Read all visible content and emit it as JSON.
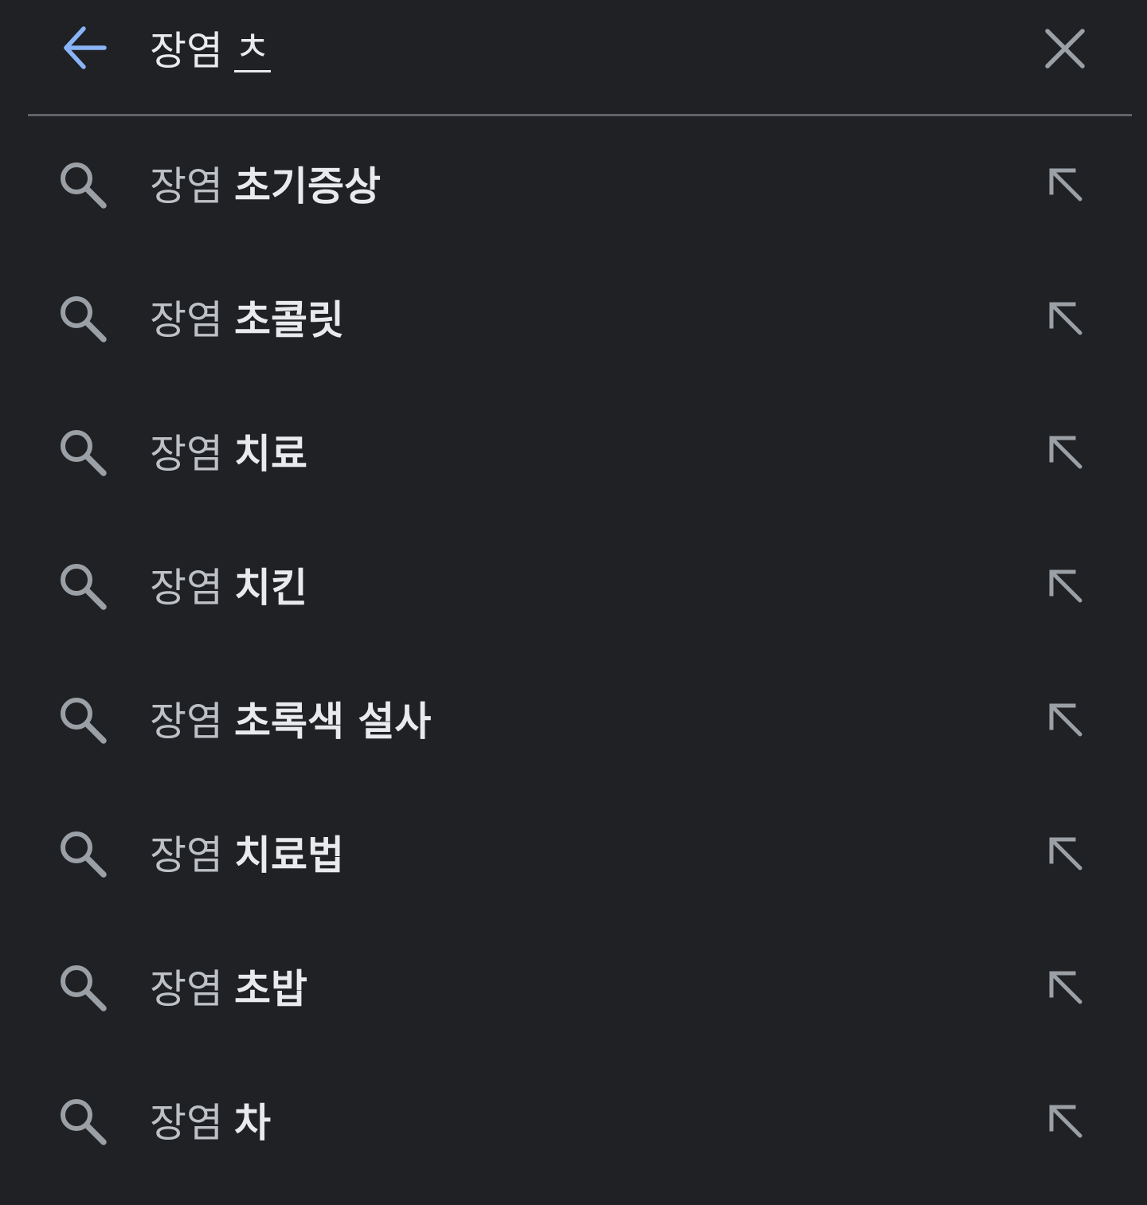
{
  "colors": {
    "background": "#202124",
    "back_arrow": "#8ab4f8",
    "icon": "#9aa0a6",
    "text_primary": "#e8eaed",
    "text_secondary": "#bdc1c6",
    "divider": "#5f6368"
  },
  "header": {
    "back_icon": "arrow-left-icon",
    "query_prefix": "장염",
    "query_composing": "ㅊ",
    "clear_icon": "close-icon"
  },
  "suggestions": [
    {
      "prefix": "장염",
      "suffix": "초기증상",
      "icon": "search-icon",
      "action_icon": "arrow-up-left-icon"
    },
    {
      "prefix": "장염",
      "suffix": "초콜릿",
      "icon": "search-icon",
      "action_icon": "arrow-up-left-icon"
    },
    {
      "prefix": "장염",
      "suffix": "치료",
      "icon": "search-icon",
      "action_icon": "arrow-up-left-icon"
    },
    {
      "prefix": "장염",
      "suffix": "치킨",
      "icon": "search-icon",
      "action_icon": "arrow-up-left-icon"
    },
    {
      "prefix": "장염",
      "suffix": "초록색 설사",
      "icon": "search-icon",
      "action_icon": "arrow-up-left-icon"
    },
    {
      "prefix": "장염",
      "suffix": "치료법",
      "icon": "search-icon",
      "action_icon": "arrow-up-left-icon"
    },
    {
      "prefix": "장염",
      "suffix": "초밥",
      "icon": "search-icon",
      "action_icon": "arrow-up-left-icon"
    },
    {
      "prefix": "장염",
      "suffix": "차",
      "icon": "search-icon",
      "action_icon": "arrow-up-left-icon"
    }
  ]
}
